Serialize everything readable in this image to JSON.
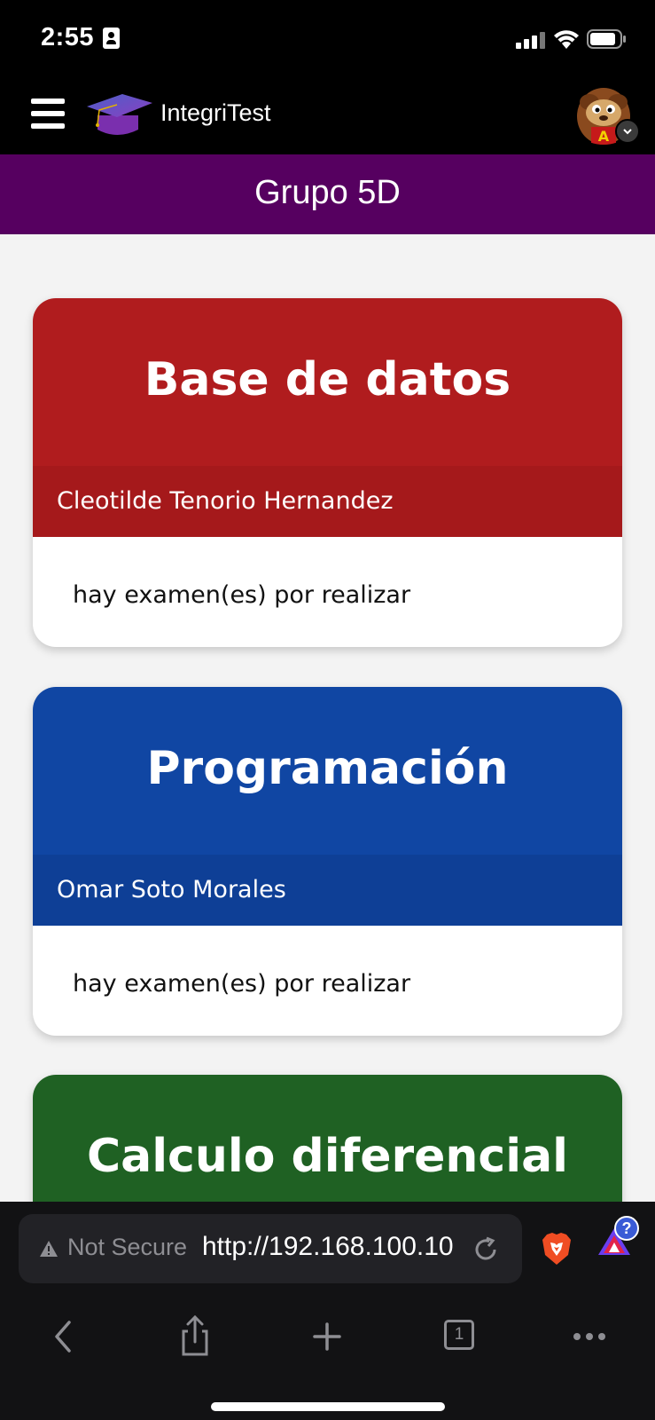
{
  "status_bar": {
    "time": "2:55"
  },
  "header": {
    "brand": "IntegriTest"
  },
  "group": {
    "title": "Grupo 5D"
  },
  "courses": [
    {
      "title": "Base de datos",
      "teacher": "Cleotilde Tenorio Hernandez",
      "status": "hay examen(es) por realizar",
      "color": "#b01c1e",
      "teacher_bar_color": "#a5191b"
    },
    {
      "title": "Programación",
      "teacher": "Omar Soto Morales",
      "status": "hay examen(es) por realizar",
      "color": "#1046a3",
      "teacher_bar_color": "#0e3f96"
    },
    {
      "title": "Calculo diferencial",
      "teacher": "",
      "status": "",
      "color": "#1f6123",
      "teacher_bar_color": "#1b5720"
    }
  ],
  "browser": {
    "security_label": "Not Secure",
    "url": "http://192.168.100.10",
    "tab_count": "1",
    "rewards_badge": "?"
  }
}
